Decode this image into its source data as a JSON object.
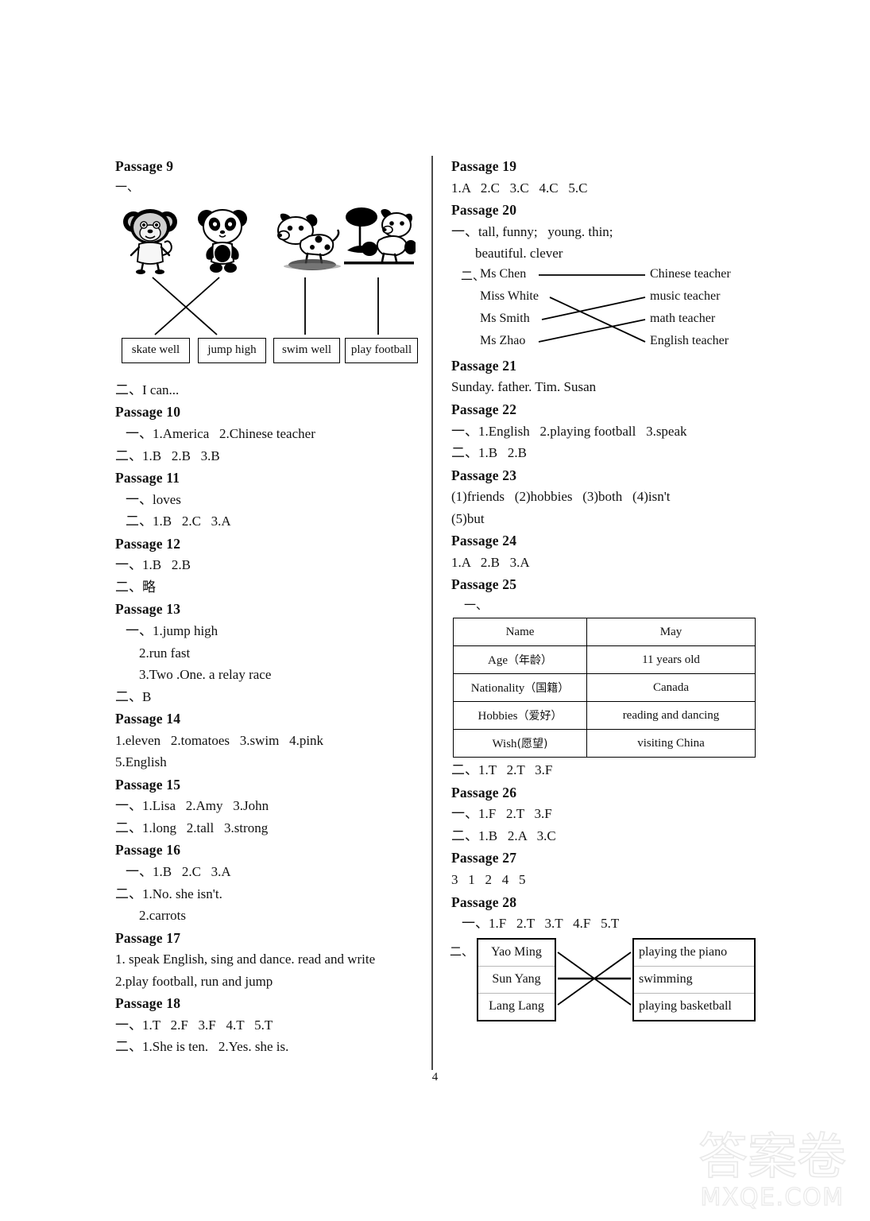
{
  "page": {
    "number": "4"
  },
  "watermark": {
    "cn": "答案卷",
    "url": "MXQE.COM"
  },
  "left_column": {
    "passage9": {
      "title": "Passage 9",
      "part1_marker": "一、",
      "pictures": [
        "monkey",
        "panda",
        "dog-swimming",
        "dog-football"
      ],
      "tags": [
        "skate well",
        "jump high",
        "swim well",
        "play football"
      ],
      "part2": "二、I can..."
    },
    "passage10": {
      "title": "Passage 10",
      "line1": "一、1.America   2.Chinese teacher",
      "line2": "二、1.B   2.B   3.B"
    },
    "passage11": {
      "title": "Passage 11",
      "line1": "一、loves",
      "line2": "二、1.B   2.C   3.A"
    },
    "passage12": {
      "title": "Passage 12",
      "line1": "一、1.B   2.B",
      "line2": "二、略"
    },
    "passage13": {
      "title": "Passage 13",
      "line1": "一、1.jump high",
      "line2": "2.run fast",
      "line3": "3.Two .One. a relay race",
      "line4": "二、B"
    },
    "passage14": {
      "title": "Passage 14",
      "line1": "1.eleven   2.tomatoes   3.swim   4.pink",
      "line2": "5.English"
    },
    "passage15": {
      "title": "Passage 15",
      "line1": "一、1.Lisa   2.Amy   3.John",
      "line2": "二、1.long   2.tall   3.strong"
    },
    "passage16": {
      "title": "Passage 16",
      "line1": "一、1.B   2.C   3.A",
      "line2": "二、1.No. she isn't.",
      "line3": "2.carrots"
    },
    "passage17": {
      "title": "Passage 17",
      "line1": "1. speak English, sing and dance. read and write",
      "line2": "2.play football, run and jump"
    },
    "passage18": {
      "title": "Passage 18",
      "line1": "一、1.T   2.F   3.F   4.T   5.T",
      "line2": "二、1.She is ten.   2.Yes. she is."
    }
  },
  "right_column": {
    "passage19": {
      "title": "Passage 19",
      "line1": "1.A   2.C   3.C   4.C   5.C"
    },
    "passage20": {
      "title": "Passage 20",
      "line1": "一、tall, funny;   young. thin;",
      "line2": "beautiful. clever",
      "part2_marker": "二、",
      "left_items": [
        "Ms Chen",
        "Miss White",
        "Ms Smith",
        "Ms Zhao"
      ],
      "right_items": [
        "Chinese teacher",
        "music teacher",
        "math teacher",
        "English teacher"
      ],
      "matches": [
        [
          0,
          0
        ],
        [
          1,
          3
        ],
        [
          2,
          1
        ],
        [
          3,
          2
        ]
      ]
    },
    "passage21": {
      "title": "Passage 21",
      "line1": "Sunday. father. Tim. Susan"
    },
    "passage22": {
      "title": "Passage 22",
      "line1": "一、1.English   2.playing football   3.speak",
      "line2": "二、1.B   2.B"
    },
    "passage23": {
      "title": "Passage 23",
      "line1": "(1)friends   (2)hobbies   (3)both   (4)isn't",
      "line2": "(5)but"
    },
    "passage24": {
      "title": "Passage 24",
      "line1": "1.A   2.B   3.A"
    },
    "passage25": {
      "title": "Passage 25",
      "part1_marker": "一、",
      "table": [
        {
          "label": "Name",
          "zh": "",
          "value": "May"
        },
        {
          "label": "Age",
          "zh": "（年龄）",
          "value": "11 years old"
        },
        {
          "label": "Nationality",
          "zh": "（国籍）",
          "value": "Canada"
        },
        {
          "label": "Hobbies",
          "zh": "（爱好）",
          "value": "reading and dancing"
        },
        {
          "label": "Wish",
          "zh": "(愿望)",
          "value": "visiting China"
        }
      ],
      "line_after": "二、1.T   2.T   3.F"
    },
    "passage26": {
      "title": "Passage 26",
      "line1": "一、1.F   2.T   3.F",
      "line2": "二、1.B   2.A   3.C"
    },
    "passage27": {
      "title": "Passage 27",
      "line1": "3   1   2   4   5"
    },
    "passage28": {
      "title": "Passage 28",
      "line1": "一、1.F   2.T   3.T   4.F   5.T",
      "part2_marker": "二、",
      "left_items": [
        "Yao Ming",
        "Sun Yang",
        "Lang Lang"
      ],
      "right_items": [
        "playing the piano",
        "swimming",
        "playing basketball"
      ],
      "matches": [
        [
          0,
          2
        ],
        [
          1,
          1
        ],
        [
          2,
          0
        ]
      ]
    }
  }
}
